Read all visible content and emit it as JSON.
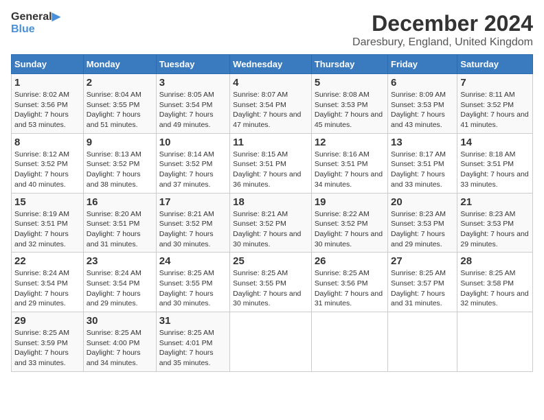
{
  "header": {
    "logo_general": "General",
    "logo_blue": "Blue",
    "main_title": "December 2024",
    "subtitle": "Daresbury, England, United Kingdom"
  },
  "days_of_week": [
    "Sunday",
    "Monday",
    "Tuesday",
    "Wednesday",
    "Thursday",
    "Friday",
    "Saturday"
  ],
  "weeks": [
    [
      {
        "day": "1",
        "sunrise": "Sunrise: 8:02 AM",
        "sunset": "Sunset: 3:56 PM",
        "daylight": "Daylight: 7 hours and 53 minutes."
      },
      {
        "day": "2",
        "sunrise": "Sunrise: 8:04 AM",
        "sunset": "Sunset: 3:55 PM",
        "daylight": "Daylight: 7 hours and 51 minutes."
      },
      {
        "day": "3",
        "sunrise": "Sunrise: 8:05 AM",
        "sunset": "Sunset: 3:54 PM",
        "daylight": "Daylight: 7 hours and 49 minutes."
      },
      {
        "day": "4",
        "sunrise": "Sunrise: 8:07 AM",
        "sunset": "Sunset: 3:54 PM",
        "daylight": "Daylight: 7 hours and 47 minutes."
      },
      {
        "day": "5",
        "sunrise": "Sunrise: 8:08 AM",
        "sunset": "Sunset: 3:53 PM",
        "daylight": "Daylight: 7 hours and 45 minutes."
      },
      {
        "day": "6",
        "sunrise": "Sunrise: 8:09 AM",
        "sunset": "Sunset: 3:53 PM",
        "daylight": "Daylight: 7 hours and 43 minutes."
      },
      {
        "day": "7",
        "sunrise": "Sunrise: 8:11 AM",
        "sunset": "Sunset: 3:52 PM",
        "daylight": "Daylight: 7 hours and 41 minutes."
      }
    ],
    [
      {
        "day": "8",
        "sunrise": "Sunrise: 8:12 AM",
        "sunset": "Sunset: 3:52 PM",
        "daylight": "Daylight: 7 hours and 40 minutes."
      },
      {
        "day": "9",
        "sunrise": "Sunrise: 8:13 AM",
        "sunset": "Sunset: 3:52 PM",
        "daylight": "Daylight: 7 hours and 38 minutes."
      },
      {
        "day": "10",
        "sunrise": "Sunrise: 8:14 AM",
        "sunset": "Sunset: 3:52 PM",
        "daylight": "Daylight: 7 hours and 37 minutes."
      },
      {
        "day": "11",
        "sunrise": "Sunrise: 8:15 AM",
        "sunset": "Sunset: 3:51 PM",
        "daylight": "Daylight: 7 hours and 36 minutes."
      },
      {
        "day": "12",
        "sunrise": "Sunrise: 8:16 AM",
        "sunset": "Sunset: 3:51 PM",
        "daylight": "Daylight: 7 hours and 34 minutes."
      },
      {
        "day": "13",
        "sunrise": "Sunrise: 8:17 AM",
        "sunset": "Sunset: 3:51 PM",
        "daylight": "Daylight: 7 hours and 33 minutes."
      },
      {
        "day": "14",
        "sunrise": "Sunrise: 8:18 AM",
        "sunset": "Sunset: 3:51 PM",
        "daylight": "Daylight: 7 hours and 33 minutes."
      }
    ],
    [
      {
        "day": "15",
        "sunrise": "Sunrise: 8:19 AM",
        "sunset": "Sunset: 3:51 PM",
        "daylight": "Daylight: 7 hours and 32 minutes."
      },
      {
        "day": "16",
        "sunrise": "Sunrise: 8:20 AM",
        "sunset": "Sunset: 3:51 PM",
        "daylight": "Daylight: 7 hours and 31 minutes."
      },
      {
        "day": "17",
        "sunrise": "Sunrise: 8:21 AM",
        "sunset": "Sunset: 3:52 PM",
        "daylight": "Daylight: 7 hours and 30 minutes."
      },
      {
        "day": "18",
        "sunrise": "Sunrise: 8:21 AM",
        "sunset": "Sunset: 3:52 PM",
        "daylight": "Daylight: 7 hours and 30 minutes."
      },
      {
        "day": "19",
        "sunrise": "Sunrise: 8:22 AM",
        "sunset": "Sunset: 3:52 PM",
        "daylight": "Daylight: 7 hours and 30 minutes."
      },
      {
        "day": "20",
        "sunrise": "Sunrise: 8:23 AM",
        "sunset": "Sunset: 3:53 PM",
        "daylight": "Daylight: 7 hours and 29 minutes."
      },
      {
        "day": "21",
        "sunrise": "Sunrise: 8:23 AM",
        "sunset": "Sunset: 3:53 PM",
        "daylight": "Daylight: 7 hours and 29 minutes."
      }
    ],
    [
      {
        "day": "22",
        "sunrise": "Sunrise: 8:24 AM",
        "sunset": "Sunset: 3:54 PM",
        "daylight": "Daylight: 7 hours and 29 minutes."
      },
      {
        "day": "23",
        "sunrise": "Sunrise: 8:24 AM",
        "sunset": "Sunset: 3:54 PM",
        "daylight": "Daylight: 7 hours and 29 minutes."
      },
      {
        "day": "24",
        "sunrise": "Sunrise: 8:25 AM",
        "sunset": "Sunset: 3:55 PM",
        "daylight": "Daylight: 7 hours and 30 minutes."
      },
      {
        "day": "25",
        "sunrise": "Sunrise: 8:25 AM",
        "sunset": "Sunset: 3:55 PM",
        "daylight": "Daylight: 7 hours and 30 minutes."
      },
      {
        "day": "26",
        "sunrise": "Sunrise: 8:25 AM",
        "sunset": "Sunset: 3:56 PM",
        "daylight": "Daylight: 7 hours and 31 minutes."
      },
      {
        "day": "27",
        "sunrise": "Sunrise: 8:25 AM",
        "sunset": "Sunset: 3:57 PM",
        "daylight": "Daylight: 7 hours and 31 minutes."
      },
      {
        "day": "28",
        "sunrise": "Sunrise: 8:25 AM",
        "sunset": "Sunset: 3:58 PM",
        "daylight": "Daylight: 7 hours and 32 minutes."
      }
    ],
    [
      {
        "day": "29",
        "sunrise": "Sunrise: 8:25 AM",
        "sunset": "Sunset: 3:59 PM",
        "daylight": "Daylight: 7 hours and 33 minutes."
      },
      {
        "day": "30",
        "sunrise": "Sunrise: 8:25 AM",
        "sunset": "Sunset: 4:00 PM",
        "daylight": "Daylight: 7 hours and 34 minutes."
      },
      {
        "day": "31",
        "sunrise": "Sunrise: 8:25 AM",
        "sunset": "Sunset: 4:01 PM",
        "daylight": "Daylight: 7 hours and 35 minutes."
      },
      null,
      null,
      null,
      null
    ]
  ]
}
